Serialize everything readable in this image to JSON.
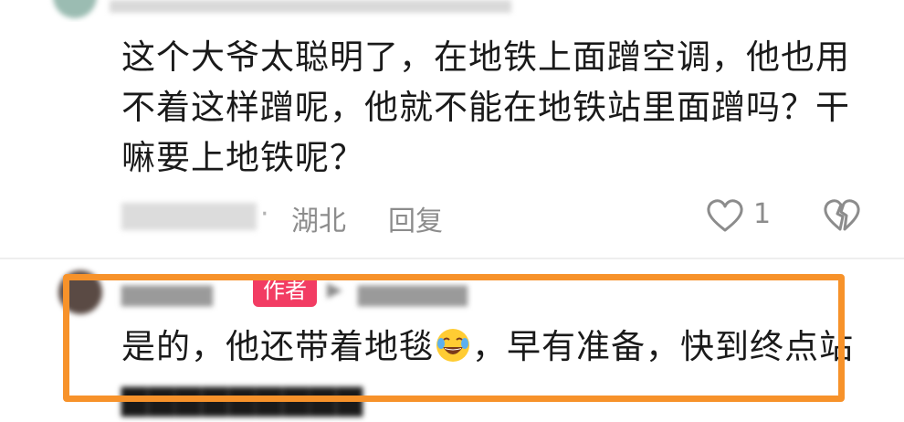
{
  "top_comment": {
    "text": "这个大爷太聪明了，在地铁上面蹭空调，他也用\n不着这样蹭呢，他就不能在地铁站里面蹭吗？干\n嘛要上地铁呢？",
    "separator": "·",
    "location": "湖北",
    "reply_label": "回复",
    "like_count": "1",
    "like_icon": "heart-outline-icon",
    "dislike_icon": "broken-heart-icon"
  },
  "reply": {
    "author_badge": "作者",
    "text_before_emoji": "是的，他还带着地毯",
    "emoji": "laughing-crying-emoji",
    "text_after_emoji": "，早有准备，快到终点站"
  },
  "colors": {
    "highlight_border": "#f7922a",
    "author_badge_bg": "#f23c63",
    "meta_text": "#8c8c8c",
    "body_text": "#1a1a1a"
  }
}
